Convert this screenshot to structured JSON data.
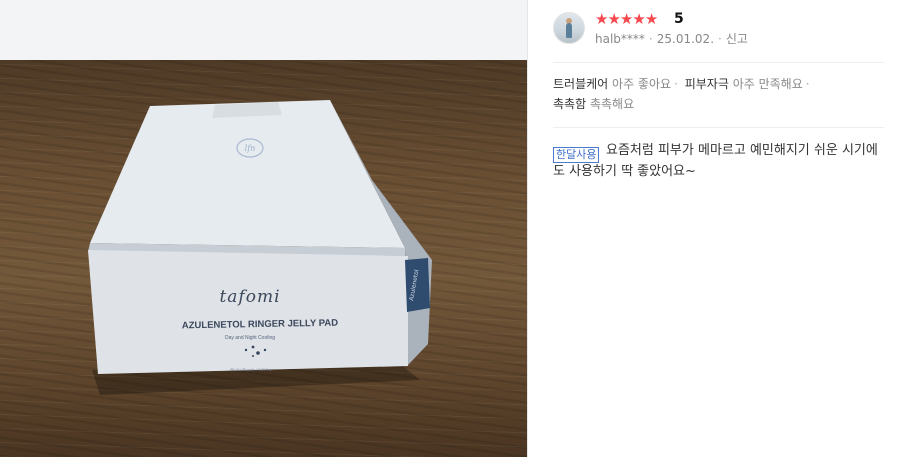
{
  "product_photo": {
    "brand": "tafomi",
    "product_name": "AZULENETOL RINGER JELLY PAD",
    "subtitle": "Day and Night Cooling",
    "emblem": "lfn",
    "side_tag": "Azulenetol",
    "footer_fineprint": "80 / 0 / 80 pads / 6.66 fl.oz."
  },
  "review": {
    "rating_stars": 5,
    "rating_value": "5",
    "user": "halb****",
    "date": "25.01.02.",
    "report_label": "신고",
    "tags": [
      {
        "key": "트러블케어",
        "value": "아주 좋아요"
      },
      {
        "key": "피부자극",
        "value": "아주 만족해요"
      },
      {
        "key": "촉촉함",
        "value": "촉촉해요"
      }
    ],
    "usage_badge": "한달사용",
    "text": "요즘처럼 피부가 메마르고 예민해지기 쉬운 시기에도 사용하기 딱 좋았어요~"
  },
  "colors": {
    "star": "#f5494f",
    "badge": "#3f70c9",
    "left_background": "#f3f4f6"
  },
  "icons": [
    "star-icon",
    "avatar"
  ]
}
